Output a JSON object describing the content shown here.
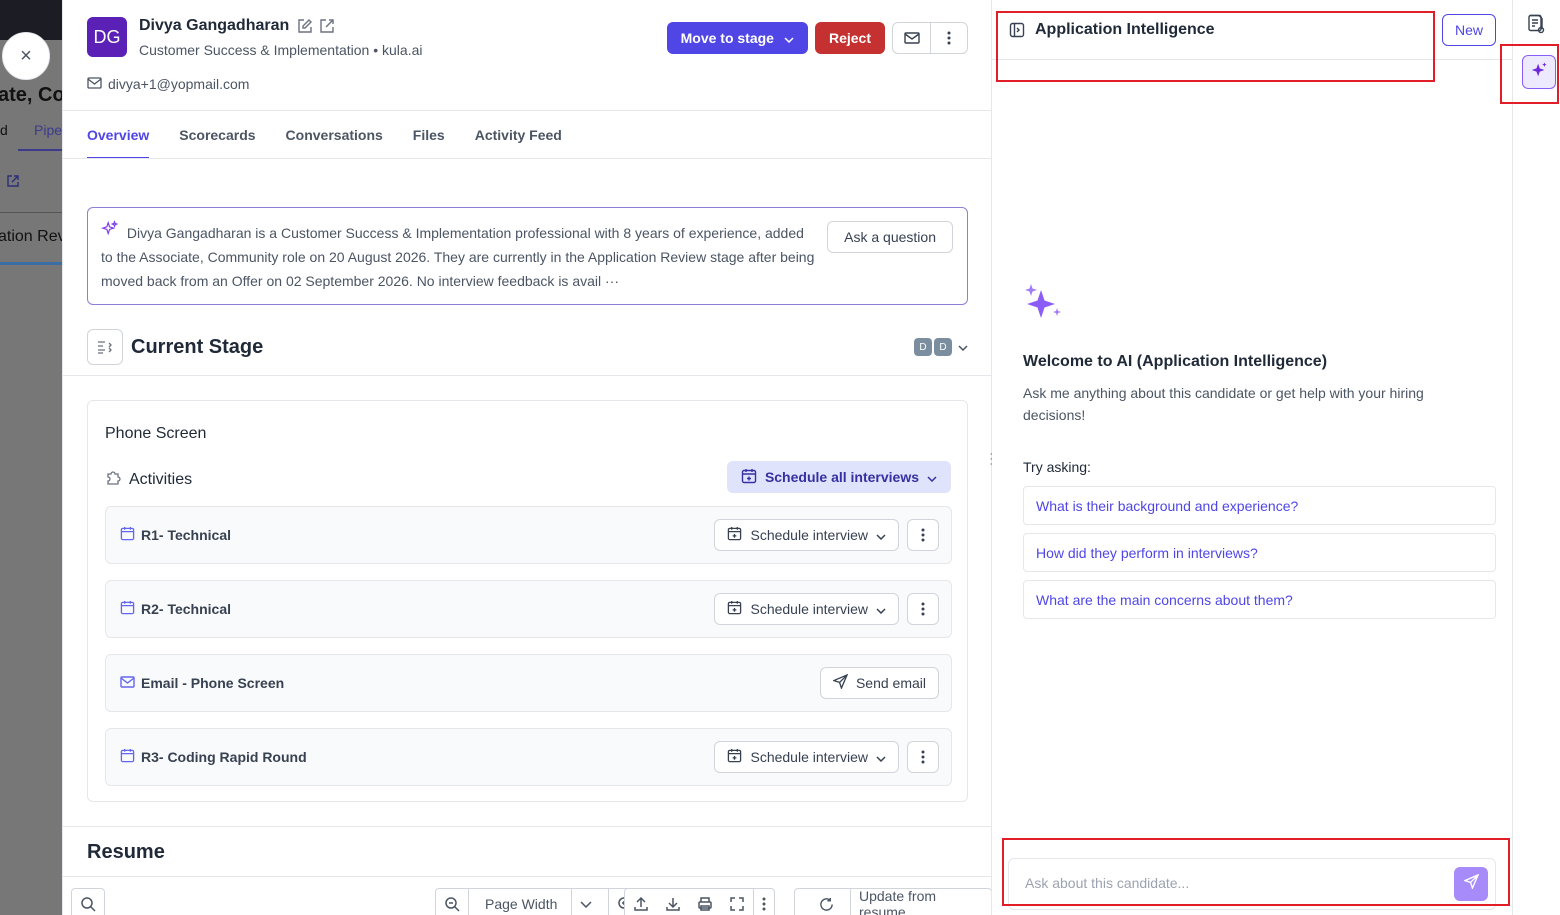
{
  "background": {
    "title_fragment": "ate, Co",
    "tab_fragment_1": "d",
    "tab_fragment_2": "Pipe",
    "stage_fragment": "ation Rev"
  },
  "close_label": "×",
  "candidate": {
    "initials": "DG",
    "name": "Divya Gangadharan",
    "role": "Customer Success & Implementation",
    "separator": "•",
    "company": "kula.ai",
    "email": "divya+1@yopmail.com"
  },
  "header_actions": {
    "move_to_stage": "Move to stage",
    "reject": "Reject"
  },
  "tabs": [
    {
      "label": "Overview",
      "active": true
    },
    {
      "label": "Scorecards",
      "active": false
    },
    {
      "label": "Conversations",
      "active": false
    },
    {
      "label": "Files",
      "active": false
    },
    {
      "label": "Activity Feed",
      "active": false
    }
  ],
  "summary": {
    "text": "Divya Gangadharan is a Customer Success & Implementation professional with 8 years of experience, added to the Associate, Community role on 20 August 2026. They are currently in the Application Review stage after being moved back from an Offer on 02 September 2026. No interview feedback is avail",
    "ellipsis": "···",
    "ask_button": "Ask a question"
  },
  "current_stage": {
    "title": "Current Stage",
    "avatars": [
      "D",
      "D"
    ],
    "stage_name": "Phone Screen",
    "activities_label": "Activities",
    "schedule_all": "Schedule all interviews",
    "activities": [
      {
        "icon": "calendar-icon",
        "label": "R1- Technical",
        "action": "Schedule interview",
        "more": true
      },
      {
        "icon": "calendar-icon",
        "label": "R2- Technical",
        "action": "Schedule interview",
        "more": true
      },
      {
        "icon": "mail-icon",
        "label": "Email - Phone Screen",
        "action": "Send email",
        "more": false
      },
      {
        "icon": "calendar-icon",
        "label": "R3- Coding Rapid Round",
        "action": "Schedule interview",
        "more": true
      }
    ]
  },
  "resume": {
    "title": "Resume",
    "zoom_mode": "Page Width",
    "update_button": "Update from resume"
  },
  "ai_panel": {
    "title": "Application Intelligence",
    "new_button": "New",
    "welcome_title": "Welcome to AI (Application Intelligence)",
    "welcome_desc": "Ask me anything about this candidate or get help with your hiring decisions!",
    "try_asking": "Try asking:",
    "suggestions": [
      "What is their background and experience?",
      "How did they perform in interviews?",
      "What are the main concerns about them?"
    ],
    "input_placeholder": "Ask about this candidate...",
    "input_value": ""
  },
  "colors": {
    "accent": "#4f46e5",
    "danger": "#c53030",
    "highlight": "#e11d28"
  }
}
